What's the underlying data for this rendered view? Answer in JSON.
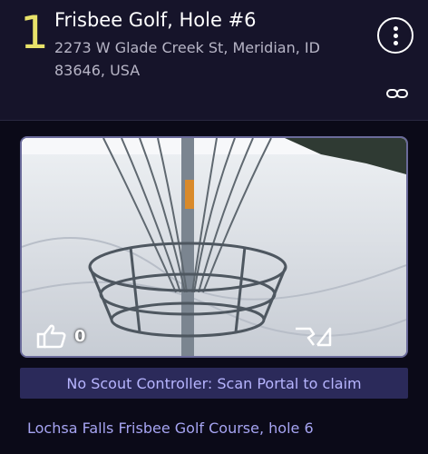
{
  "portal": {
    "rank": "1",
    "title": "Frisbee Golf, Hole #6",
    "address": "2273 W Glade Creek St, Meridian, ID 83646, USA",
    "likes": "0",
    "claim_text": "No Scout Controller: Scan Portal to claim",
    "description": "Lochsa Falls Frisbee Golf Course, hole 6"
  },
  "icons": {
    "menu": "more-vertical-icon",
    "link": "link-icon",
    "like": "thumbs-up-icon",
    "report": "report-icon"
  },
  "colors": {
    "accent_yellow": "#e8e26a",
    "claim_bg": "#2b2a5a",
    "claim_text": "#b7b5ff",
    "link_text": "#a6a4f2"
  }
}
